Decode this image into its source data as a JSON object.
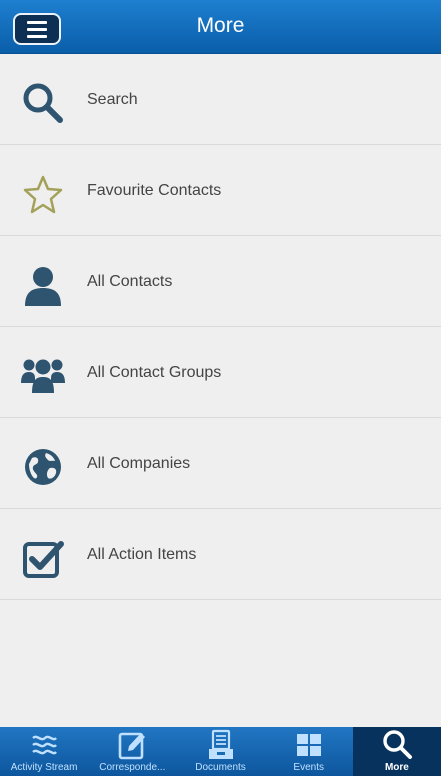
{
  "header": {
    "title": "More",
    "menu_icon": "hamburger-icon"
  },
  "menu_items": [
    {
      "label": "Search",
      "icon": "search-icon"
    },
    {
      "label": "Favourite Contacts",
      "icon": "star-icon"
    },
    {
      "label": "All Contacts",
      "icon": "person-icon"
    },
    {
      "label": "All Contact Groups",
      "icon": "group-icon"
    },
    {
      "label": "All Companies",
      "icon": "globe-icon"
    },
    {
      "label": "All Action Items",
      "icon": "checkbox-icon"
    }
  ],
  "tabs": [
    {
      "label": "Activity Stream",
      "icon": "waves-icon",
      "active": false
    },
    {
      "label": "Corresponde...",
      "icon": "edit-icon",
      "active": false
    },
    {
      "label": "Documents",
      "icon": "document-tray-icon",
      "active": false
    },
    {
      "label": "Events",
      "icon": "grid-icon",
      "active": false
    },
    {
      "label": "More",
      "icon": "search-icon",
      "active": true
    }
  ],
  "colors": {
    "header_blue": "#0a5ea9",
    "icon_slate": "#2f5470",
    "star_olive": "#a3a159",
    "tab_active": "#07325d"
  }
}
